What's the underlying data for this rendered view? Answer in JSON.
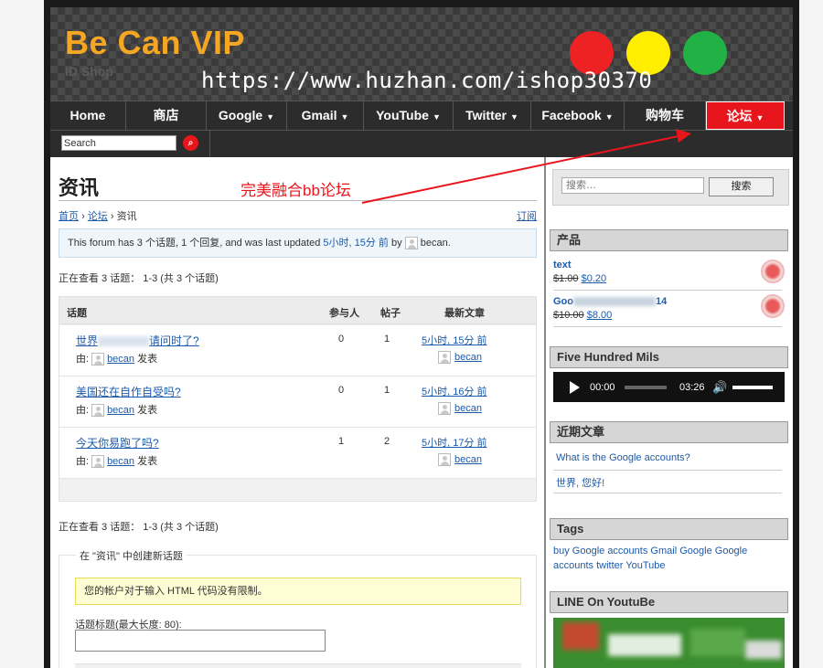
{
  "header": {
    "site_title": "Be Can VIP",
    "site_subtitle": "ID Shop",
    "watermark_url": "https://www.huzhan.com/ishop30370"
  },
  "colors": {
    "title": "#f5a623",
    "nav_active": "#e8161c",
    "link": "#1d5aa8",
    "dot_red": "#ee2222",
    "dot_yellow": "#ffee00",
    "dot_green": "#22b144"
  },
  "nav": {
    "items": [
      {
        "label": "Home",
        "dropdown": false
      },
      {
        "label": "商店",
        "dropdown": false
      },
      {
        "label": "Google",
        "dropdown": true
      },
      {
        "label": "Gmail",
        "dropdown": true
      },
      {
        "label": "YouTube",
        "dropdown": true
      },
      {
        "label": "Twitter",
        "dropdown": true
      },
      {
        "label": "Facebook",
        "dropdown": true
      },
      {
        "label": "购物车",
        "dropdown": false
      },
      {
        "label": "论坛",
        "dropdown": true,
        "active": true
      }
    ],
    "search_value": "Search"
  },
  "main": {
    "page_title": "资讯",
    "annotation": "完美融合bb论坛",
    "breadcrumb": {
      "home": "首页",
      "forum": "论坛",
      "current": "资讯",
      "sep": "›"
    },
    "subscribe": "订阅",
    "info_text": "This forum has 3 个话题, 1 个回复, and was last updated",
    "info_time": "5小时, 15分 前",
    "info_by": "by",
    "info_user": "becan.",
    "viewing": "正在查看 3 话题： 1-3 (共 3 个话题)",
    "columns": {
      "topic": "话题",
      "voices": "参与人",
      "posts": "帖子",
      "freshness": "最新文章"
    },
    "topics": [
      {
        "title_start": "世界",
        "title_end": "请问时了?",
        "by_label": "由:",
        "author": "becan",
        "posted": "发表",
        "voices": "0",
        "posts": "1",
        "freshness": "5小时, 15分 前",
        "fresh_user": "becan"
      },
      {
        "title_start": "美国还在自作自受吗?",
        "title_end": "",
        "by_label": "由:",
        "author": "becan",
        "posted": "发表",
        "voices": "0",
        "posts": "1",
        "freshness": "5小时, 16分 前",
        "fresh_user": "becan"
      },
      {
        "title_start": "今天你易跑了吗?",
        "title_end": "",
        "by_label": "由:",
        "author": "becan",
        "posted": "发表",
        "voices": "1",
        "posts": "2",
        "freshness": "5小时, 17分 前",
        "fresh_user": "becan"
      }
    ],
    "new_topic": {
      "legend": "在 \"资讯\" 中创建新话题",
      "notice": "您的帐户对于输入 HTML 代码没有限制。",
      "title_label": "话题标题(最大长度: 80):"
    }
  },
  "sidebar": {
    "search_placeholder": "搜索…",
    "search_button": "搜索",
    "products_title": "产品",
    "products": [
      {
        "name_start": "text",
        "name_end": "",
        "old_price": "$1.00",
        "new_price": "$0.20"
      },
      {
        "name_start": "Goo",
        "name_end": "14",
        "old_price": "$10.00",
        "new_price": "$8.00"
      }
    ],
    "player_title": "Five Hundred Mils",
    "player": {
      "current": "00:00",
      "duration": "03:26"
    },
    "recent_title": "近期文章",
    "recent": [
      "What is the Google accounts?",
      "世界, 您好!"
    ],
    "tags_title": "Tags",
    "tags": [
      "buy Google accounts",
      "Gmail",
      "Google",
      "Google accounts",
      "twitter",
      "YouTube"
    ],
    "line_title": "LINE On YoutuBe"
  }
}
